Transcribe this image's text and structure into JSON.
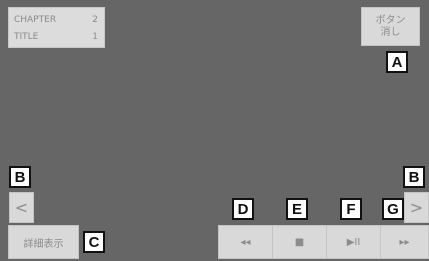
{
  "info_panel": {
    "chapter_label": "CHAPTER",
    "chapter_value": "2",
    "title_label": "TITLE",
    "title_value": "1"
  },
  "buttons": {
    "hide_buttons_line1": "ボタン",
    "hide_buttons_line2": "消し",
    "prev_arrow": "<",
    "next_arrow": ">",
    "details": "詳細表示",
    "rewind": "◂◂",
    "stop": "■",
    "play_pause": "▶II",
    "fast_forward": "▸▸"
  },
  "callouts": {
    "a": "A",
    "b_left": "B",
    "b_right": "B",
    "c": "C",
    "d": "D",
    "e": "E",
    "f": "F",
    "g": "G"
  },
  "colors": {
    "screen_bg": "#666666",
    "button_bg": "#d9d9d9",
    "button_text": "#8c8c8c",
    "callout_border": "#111111"
  }
}
